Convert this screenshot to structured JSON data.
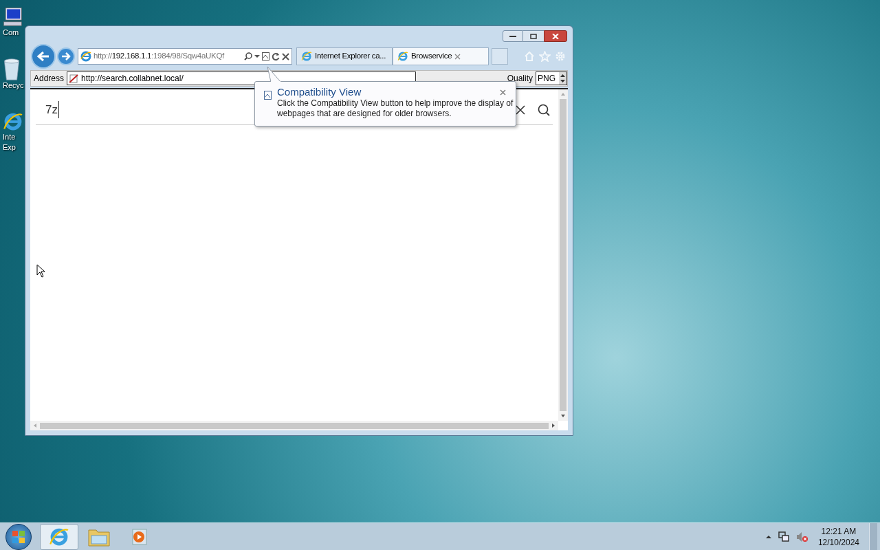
{
  "desktop": {
    "icons": [
      {
        "kind": "computer",
        "lines": [
          "Com"
        ]
      },
      {
        "kind": "recycle",
        "lines": [
          "Recyc"
        ]
      },
      {
        "kind": "browser",
        "lines": [
          "Inte",
          "Exp"
        ]
      }
    ]
  },
  "browser": {
    "url": {
      "scheme": "http://",
      "host": "192.168.1.1",
      "rest": ":1984/98/Sqw4aUKQf"
    },
    "tabs": [
      {
        "title": "Internet Explorer ca...",
        "selected": false
      },
      {
        "title": "Browservice",
        "selected": true
      }
    ],
    "address": {
      "label": "Address",
      "value": "http://search.collabnet.local/"
    },
    "quality": {
      "label": "Quality",
      "value": "PNG"
    },
    "page": {
      "search_value": "7z"
    },
    "popup": {
      "title": "Compatibility View",
      "body": "Click the Compatibility View button to help improve the display of webpages that are designed for older browsers."
    }
  },
  "taskbar": {
    "items": [
      {
        "kind": "browser",
        "selected": true
      },
      {
        "kind": "folder",
        "selected": false
      },
      {
        "kind": "media",
        "selected": false
      }
    ],
    "time": "12:21 AM",
    "date": "12/10/2024"
  }
}
